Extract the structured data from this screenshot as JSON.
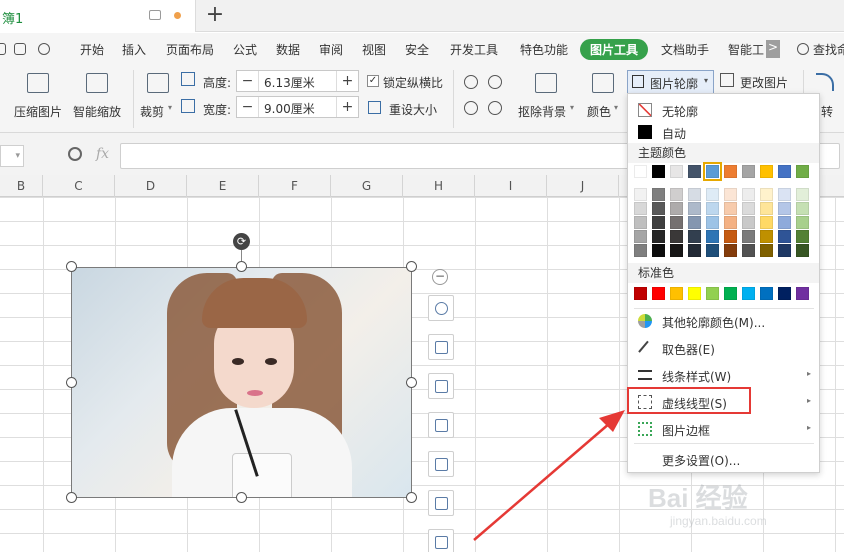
{
  "tabbar": {
    "doc_tab_label": "簿1",
    "new_tab_symbol": "+"
  },
  "menu": {
    "items": [
      "开始",
      "插入",
      "页面布局",
      "公式",
      "数据",
      "审阅",
      "视图",
      "安全",
      "开发工具",
      "特色功能",
      "图片工具",
      "文档助手",
      "智能工"
    ],
    "more_symbol": ">",
    "search_label": "查找命"
  },
  "ribbon": {
    "compress_label": "压缩图片",
    "smart_zoom_label": "智能缩放",
    "crop_label": "裁剪",
    "height_label": "高度:",
    "height_value": "6.13厘米",
    "width_label": "宽度:",
    "width_value": "9.00厘米",
    "lock_ratio_label": "锁定纵横比",
    "reset_size_label": "重设大小",
    "remove_bg_label": "抠除背景",
    "color_label": "颜色",
    "outline_label": "图片轮廓",
    "change_picture_label": "更改图片",
    "rotate_label": "转",
    "minus": "−",
    "plus": "+"
  },
  "formula_bar": {
    "fx_label": "fx"
  },
  "columns": [
    "B",
    "C",
    "D",
    "E",
    "F",
    "G",
    "H",
    "I",
    "J"
  ],
  "outline_menu": {
    "no_outline": "无轮廓",
    "auto": "自动",
    "theme_colors_header": "主题颜色",
    "standard_colors_header": "标准色",
    "other_colors": "其他轮廓颜色(M)...",
    "eyedropper": "取色器(E)",
    "line_style": "线条样式(W)",
    "dash_type": "虚线线型(S)",
    "picture_border": "图片边框",
    "more_settings": "更多设置(O)...",
    "theme_top_row": [
      "#ffffff",
      "#000000",
      "#e7e6e6",
      "#44546a",
      "#5b9bd5",
      "#ed7d31",
      "#a5a5a5",
      "#ffc000",
      "#4472c4",
      "#70ad47"
    ],
    "theme_shades": [
      [
        "#f2f2f2",
        "#7f7f7f",
        "#d0cece",
        "#d6dce4",
        "#deebf6",
        "#fbe5d5",
        "#ededed",
        "#fff2cc",
        "#dae3f3",
        "#e2efd9"
      ],
      [
        "#d8d8d8",
        "#595959",
        "#aeabab",
        "#adb9ca",
        "#bdd7ee",
        "#f7cbac",
        "#dbdbdb",
        "#fee599",
        "#b4c6e7",
        "#c5e0b3"
      ],
      [
        "#bfbfbf",
        "#3f3f3f",
        "#757070",
        "#8496b0",
        "#9dc3e6",
        "#f4b183",
        "#c9c9c9",
        "#ffd965",
        "#8eaadb",
        "#a8d08d"
      ],
      [
        "#a5a5a5",
        "#262626",
        "#3a3838",
        "#323f4f",
        "#2e75b5",
        "#c55a11",
        "#7b7b7b",
        "#bf9000",
        "#2f5496",
        "#538135"
      ],
      [
        "#7f7f7f",
        "#0c0c0c",
        "#171616",
        "#222a35",
        "#1e4e79",
        "#843c0b",
        "#525252",
        "#7f6000",
        "#1f3864",
        "#375623"
      ]
    ],
    "standard_colors": [
      "#c00000",
      "#ff0000",
      "#ffc000",
      "#ffff00",
      "#92d050",
      "#00b050",
      "#00b0f0",
      "#0070c0",
      "#002060",
      "#7030a0"
    ],
    "highlight_color": "#e53935"
  },
  "watermark": {
    "main": "Bai 经验",
    "sub": "jingyan.baidu.com"
  }
}
